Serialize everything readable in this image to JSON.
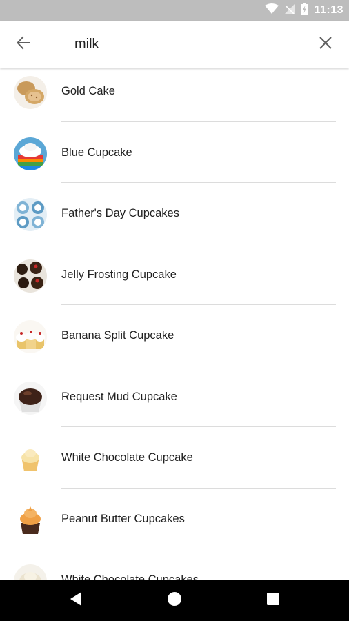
{
  "status_bar": {
    "time": "11:13",
    "icons": [
      "wifi-icon",
      "signal-off-icon",
      "battery-icon"
    ]
  },
  "search": {
    "query": "milk",
    "back_icon": "arrow-back-icon",
    "clear_icon": "close-icon"
  },
  "results": [
    {
      "label": "Gold Cake",
      "thumb": "gold-cake-thumbnail"
    },
    {
      "label": "Blue Cupcake",
      "thumb": "blue-cupcake-thumbnail"
    },
    {
      "label": "Father's Day Cupcakes",
      "thumb": "fathers-day-cupcakes-thumbnail"
    },
    {
      "label": "Jelly Frosting Cupcake",
      "thumb": "jelly-frosting-cupcake-thumbnail"
    },
    {
      "label": "Banana Split Cupcake",
      "thumb": "banana-split-cupcake-thumbnail"
    },
    {
      "label": "Request Mud Cupcake",
      "thumb": "request-mud-cupcake-thumbnail"
    },
    {
      "label": "White Chocolate Cupcake",
      "thumb": "white-chocolate-cupcake-thumbnail"
    },
    {
      "label": "Peanut Butter Cupcakes",
      "thumb": "peanut-butter-cupcakes-thumbnail"
    },
    {
      "label": "White Chocolate Cupcakes",
      "thumb": "white-chocolate-cupcakes-thumbnail"
    }
  ],
  "nav_bar": {
    "buttons": [
      "back-triangle-icon",
      "home-circle-icon",
      "recents-square-icon"
    ]
  },
  "colors": {
    "status_bar": "#bdbdbd",
    "nav_bar": "#000000",
    "text": "#212121",
    "divider": "#dcdcdc"
  }
}
